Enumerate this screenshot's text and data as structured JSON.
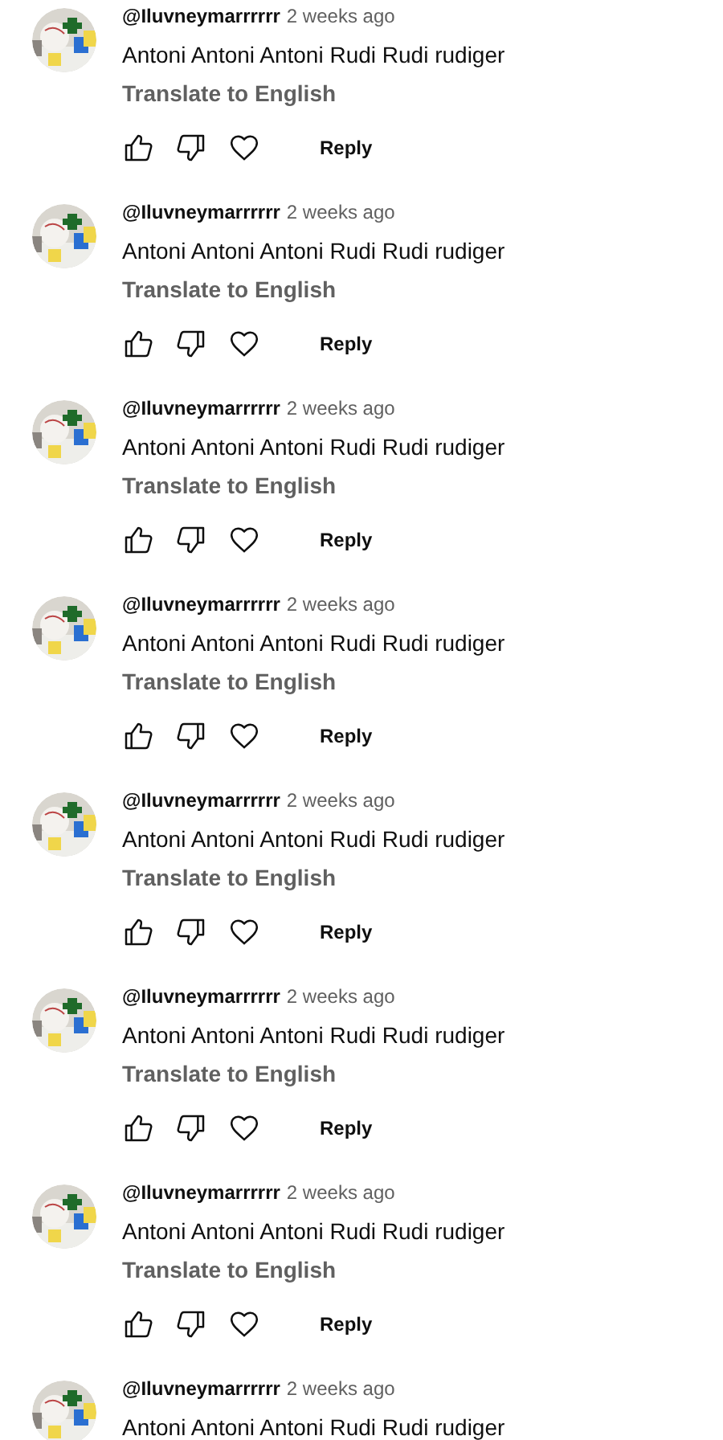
{
  "comments": [
    {
      "author": "@Iluvneymarrrrrr",
      "time": "2 weeks ago",
      "text": "Antoni Antoni Antoni Rudi Rudi rudiger",
      "translate": "Translate to English",
      "reply": "Reply"
    },
    {
      "author": "@Iluvneymarrrrrr",
      "time": "2 weeks ago",
      "text": "Antoni Antoni Antoni Rudi Rudi rudiger",
      "translate": "Translate to English",
      "reply": "Reply"
    },
    {
      "author": "@Iluvneymarrrrrr",
      "time": "2 weeks ago",
      "text": "Antoni Antoni Antoni Rudi Rudi rudiger",
      "translate": "Translate to English",
      "reply": "Reply"
    },
    {
      "author": "@Iluvneymarrrrrr",
      "time": "2 weeks ago",
      "text": "Antoni Antoni Antoni Rudi Rudi rudiger",
      "translate": "Translate to English",
      "reply": "Reply"
    },
    {
      "author": "@Iluvneymarrrrrr",
      "time": "2 weeks ago",
      "text": "Antoni Antoni Antoni Rudi Rudi rudiger",
      "translate": "Translate to English",
      "reply": "Reply"
    },
    {
      "author": "@Iluvneymarrrrrr",
      "time": "2 weeks ago",
      "text": "Antoni Antoni Antoni Rudi Rudi rudiger",
      "translate": "Translate to English",
      "reply": "Reply"
    },
    {
      "author": "@Iluvneymarrrrrr",
      "time": "2 weeks ago",
      "text": "Antoni Antoni Antoni Rudi Rudi rudiger",
      "translate": "Translate to English",
      "reply": "Reply"
    },
    {
      "author": "@Iluvneymarrrrrr",
      "time": "2 weeks ago",
      "text": "Antoni Antoni Antoni Rudi Rudi rudiger"
    }
  ]
}
